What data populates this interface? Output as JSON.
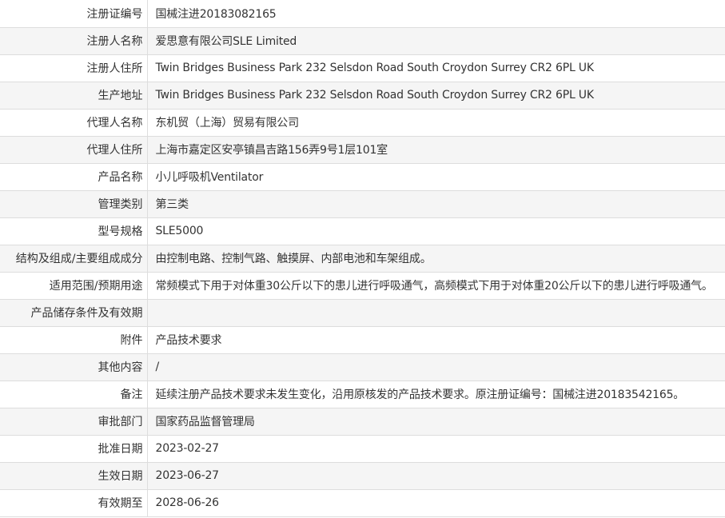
{
  "rows": [
    {
      "label": "注册证编号",
      "value": "国械注进20183082165"
    },
    {
      "label": "注册人名称",
      "value": "爱思意有限公司SLE Limited"
    },
    {
      "label": "注册人住所",
      "value": "Twin Bridges Business Park 232 Selsdon Road South Croydon Surrey CR2 6PL UK"
    },
    {
      "label": "生产地址",
      "value": "Twin Bridges Business Park 232 Selsdon Road South Croydon Surrey CR2 6PL UK"
    },
    {
      "label": "代理人名称",
      "value": "东机贸（上海）贸易有限公司"
    },
    {
      "label": "代理人住所",
      "value": "上海市嘉定区安亭镇昌吉路156弄9号1层101室"
    },
    {
      "label": "产品名称",
      "value": "小儿呼吸机Ventilator"
    },
    {
      "label": "管理类别",
      "value": "第三类"
    },
    {
      "label": "型号规格",
      "value": "SLE5000"
    },
    {
      "label": "结构及组成/主要组成成分",
      "value": "由控制电路、控制气路、触摸屏、内部电池和车架组成。"
    },
    {
      "label": "适用范围/预期用途",
      "value": "常频模式下用于对体重30公斤以下的患儿进行呼吸通气，高频模式下用于对体重20公斤以下的患儿进行呼吸通气。"
    },
    {
      "label": "产品储存条件及有效期",
      "value": ""
    },
    {
      "label": "附件",
      "value": "产品技术要求"
    },
    {
      "label": "其他内容",
      "value": "/"
    },
    {
      "label": "备注",
      "value": "延续注册产品技术要求未发生变化，沿用原核发的产品技术要求。原注册证编号：国械注进20183542165。"
    },
    {
      "label": "审批部门",
      "value": "国家药品监督管理局"
    },
    {
      "label": "批准日期",
      "value": "2023-02-27"
    },
    {
      "label": "生效日期",
      "value": "2023-06-27"
    },
    {
      "label": "有效期至",
      "value": "2028-06-26"
    }
  ]
}
